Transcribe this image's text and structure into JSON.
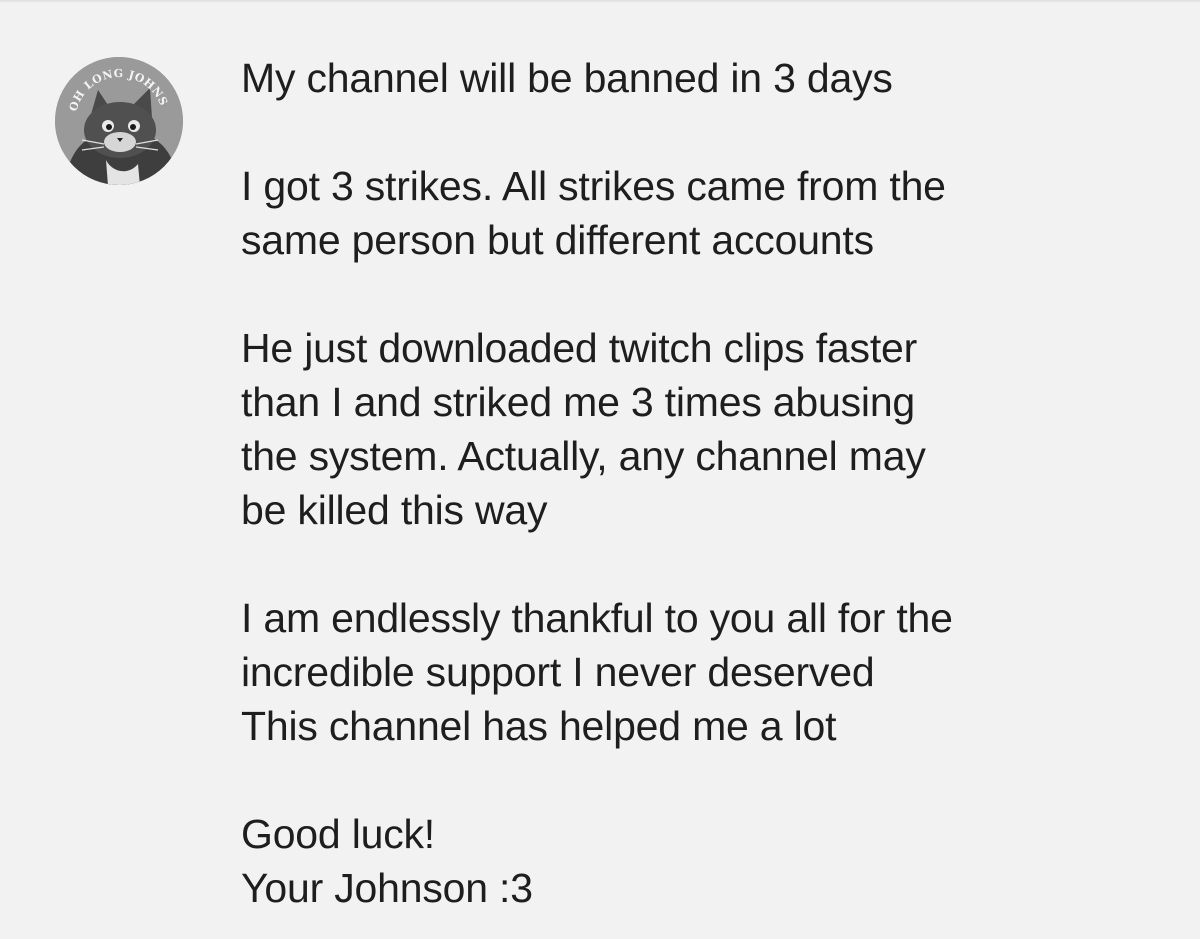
{
  "comment": {
    "avatar": {
      "icon": "cat-avatar-icon",
      "badge_text": "OH LONG JOHNSON"
    },
    "paragraphs": [
      {
        "lines": [
          "My channel will be banned in 3 days"
        ]
      },
      {
        "lines": [
          "I got 3 strikes. All strikes came from the",
          "same person but different accounts"
        ]
      },
      {
        "lines": [
          "He just downloaded twitch clips faster",
          "than I and striked me 3 times abusing",
          "the system. Actually, any channel may",
          "be killed this way"
        ]
      },
      {
        "lines": [
          "I am endlessly thankful to you all for the",
          "incredible support I never deserved",
          "This channel has helped me a lot"
        ]
      },
      {
        "lines": [
          "Good luck!",
          "Your Johnson :3"
        ]
      }
    ]
  }
}
